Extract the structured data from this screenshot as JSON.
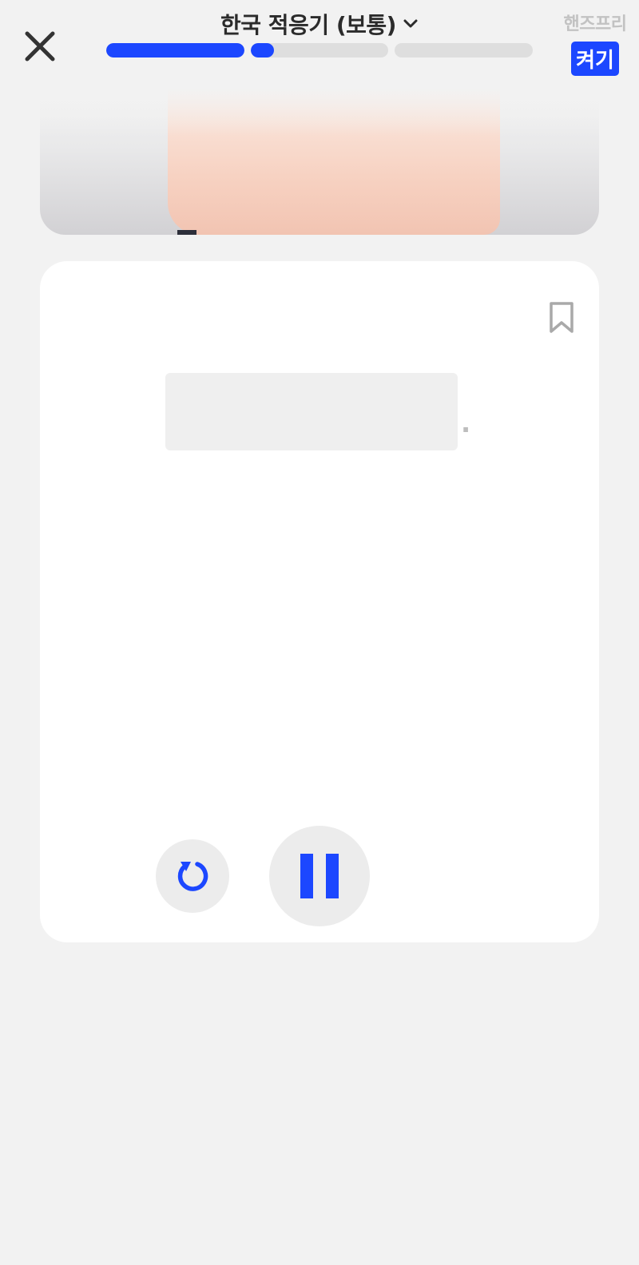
{
  "header": {
    "title": "한국 적응기 (보통)",
    "close_icon": "close-icon",
    "dropdown_icon": "chevron-down-icon"
  },
  "progress": {
    "segments": [
      1.0,
      0.17,
      0.0
    ]
  },
  "handsfree": {
    "label": "핸즈프리",
    "toggle_label": "켜기"
  },
  "card": {
    "bookmark_icon": "bookmark-icon",
    "sentence_end": "."
  },
  "controls": {
    "replay_icon": "replay-icon",
    "pause_icon": "pause-icon"
  },
  "colors": {
    "accent": "#1c47ff",
    "background": "#f2f2f2",
    "card": "#ffffff",
    "track": "#dedede",
    "muted_text": "#c2c2c2"
  }
}
